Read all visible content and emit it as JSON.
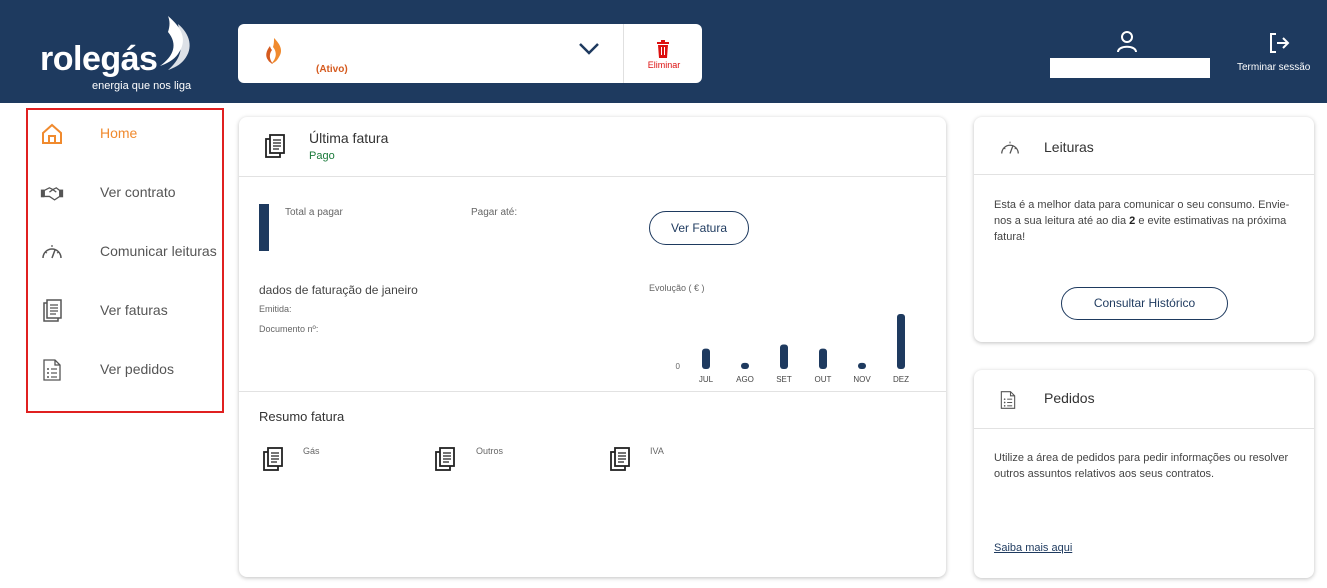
{
  "header": {
    "logo_text": "rolegás",
    "logo_tagline": "energia que nos liga",
    "contract_status": "(Ativo)",
    "delete_label": "Eliminar",
    "logout_label": "Terminar sessão"
  },
  "sidebar": {
    "items": [
      {
        "label": "Home",
        "icon": "home-icon",
        "active": true
      },
      {
        "label": "Ver contrato",
        "icon": "handshake-icon"
      },
      {
        "label": "Comunicar leituras",
        "icon": "gauge-icon"
      },
      {
        "label": "Ver faturas",
        "icon": "document-icon"
      },
      {
        "label": "Ver pedidos",
        "icon": "list-document-icon"
      }
    ]
  },
  "invoice": {
    "title": "Última fatura",
    "status": "Pago",
    "total_label": "Total a pagar",
    "due_label": "Pagar até:",
    "view_button": "Ver Fatura",
    "billing_title": "dados de faturação de janeiro",
    "issued_label": "Emitida:",
    "document_label": "Documento nº:",
    "summary_title": "Resumo fatura",
    "summary_items": [
      "Gás",
      "Outros",
      "IVA"
    ]
  },
  "chart_data": {
    "type": "bar",
    "title": "Evolução ( € )",
    "categories": [
      "JUL",
      "AGO",
      "SET",
      "OUT",
      "NOV",
      "DEZ"
    ],
    "values": [
      20,
      6,
      24,
      20,
      6,
      54
    ],
    "y_tick_label": "0",
    "color": "#1e3a5f"
  },
  "readings": {
    "title": "Leituras",
    "text_before": "Esta é a melhor data para comunicar o seu consumo. Envie-nos a sua leitura até ao dia ",
    "day": "2",
    "text_after": " e evite estimativas na próxima fatura!",
    "button": "Consultar Histórico"
  },
  "pedidos": {
    "title": "Pedidos",
    "text": "Utilize a área de pedidos para pedir informações ou resolver outros assuntos relativos aos seus contratos.",
    "link": "Saiba mais aqui"
  },
  "colors": {
    "navy": "#1e3a5f",
    "accent_orange": "#f08a2e",
    "delete_red": "#dd1111",
    "paid_green": "#1a7a3a",
    "highlight_border": "#e02020"
  }
}
